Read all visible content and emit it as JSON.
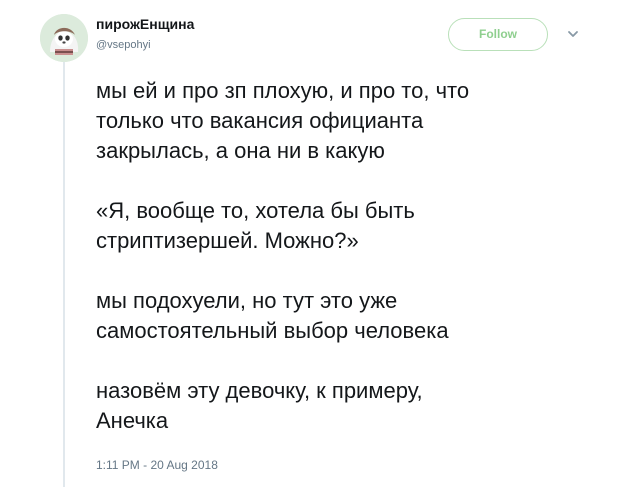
{
  "author": {
    "display_name": "пирожЕнщина",
    "handle": "@vsepohyi"
  },
  "follow_label": "Follow",
  "icons": {
    "avatar": "avatar-image",
    "more": "chevron-down-icon"
  },
  "colors": {
    "follow_border": "#b9e0b9",
    "follow_text": "#8fcf8f",
    "text": "#14171a",
    "muted": "#657786",
    "thread_line": "#e1e8ed"
  },
  "tweet": {
    "paragraphs": [
      {
        "line1": "мы ей и про зп плохую, и про то, что",
        "line2": "только что вакансия официанта",
        "line3": "закрылась, а она ни в какую"
      },
      {
        "line1": "«Я, вообще то, хотела бы быть",
        "line2": "стриптизершей. Можно?»"
      },
      {
        "line1": "мы подохуели, но тут это уже",
        "line2": "самостоятельный выбор человека"
      },
      {
        "line1": "назовём эту девочку, к примеру,",
        "line2": "Анечка"
      }
    ],
    "timestamp": "1:11 PM - 20 Aug 2018"
  }
}
